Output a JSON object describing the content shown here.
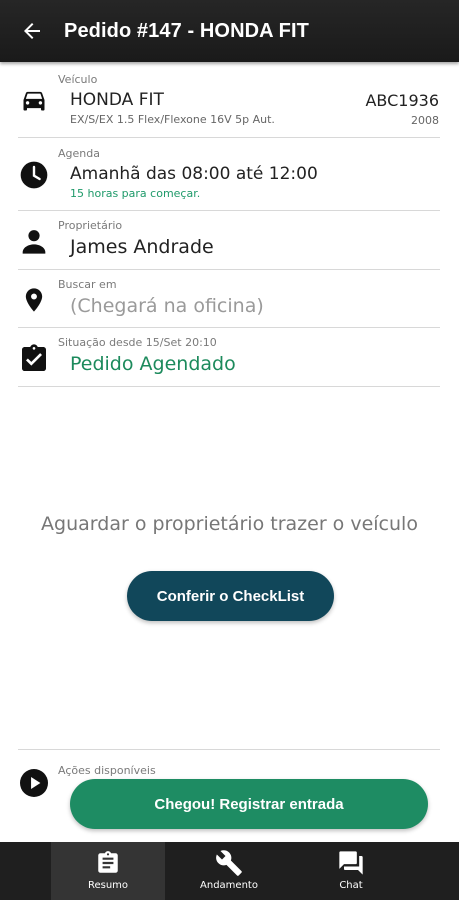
{
  "appbar": {
    "title": "Pedido #147 - HONDA FIT"
  },
  "vehicle": {
    "label": "Veículo",
    "model": "HONDA FIT",
    "version": "EX/S/EX 1.5 Flex/Flexone 16V 5p Aut.",
    "plate": "ABC1936",
    "year": "2008"
  },
  "schedule": {
    "label": "Agenda",
    "value": "Amanhã das 08:00 até 12:00",
    "note": "15 horas para começar."
  },
  "owner": {
    "label": "Proprietário",
    "value": "James Andrade"
  },
  "pickup": {
    "label": "Buscar em",
    "value": "(Chegará na oficina)"
  },
  "status": {
    "label": "Situação desde 15/Set 20:10",
    "value": "Pedido Agendado"
  },
  "wait_message": "Aguardar o proprietário trazer o veículo",
  "checklist_button": "Conferir o CheckList",
  "actions": {
    "label": "Ações disponíveis",
    "register_button": "Chegou! Registrar entrada"
  },
  "nav": {
    "items": [
      {
        "label": "Resumo",
        "icon": "clipboard-icon",
        "active": true
      },
      {
        "label": "Andamento",
        "icon": "wrench-icon",
        "active": false
      },
      {
        "label": "Chat",
        "icon": "chat-icon",
        "active": false
      }
    ]
  },
  "colors": {
    "appbar": "#1f1f1f",
    "primary_dark_teal": "#11475a",
    "accent_green": "#1e8c63"
  }
}
